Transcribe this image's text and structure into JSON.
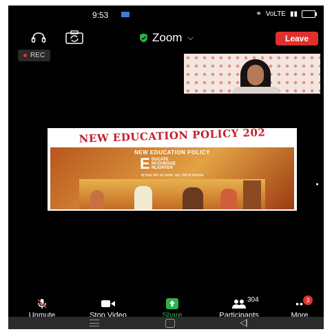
{
  "status": {
    "time": "9:53",
    "network": "VoLTE",
    "battery": "100"
  },
  "app": {
    "title": "Zoom",
    "leave_label": "Leave",
    "rec_label": "REC"
  },
  "shared_screen": {
    "title": "NEW EDUCATION POLICY 202",
    "inner_title": "NEW EDUCATION POLICY",
    "big_letter": "E",
    "acronym": [
      "DUCATE",
      "NCOURAGE",
      "NLIGHTEN"
    ],
    "hindi_line": "नई शिक्षा नीति करे सशक्त, बढ़ा, नीति हो मार्गदर्शक"
  },
  "toolbar": {
    "unmute_label": "Unmute",
    "stop_video_label": "Stop Video",
    "share_label": "Share",
    "participants_label": "Participants",
    "participants_count": "304",
    "more_label": "More",
    "more_badge": "3"
  },
  "colors": {
    "accent_green": "#2bb24c",
    "leave_red": "#e0302e",
    "title_red": "#c41e2b",
    "badge_red": "#e0302e"
  }
}
